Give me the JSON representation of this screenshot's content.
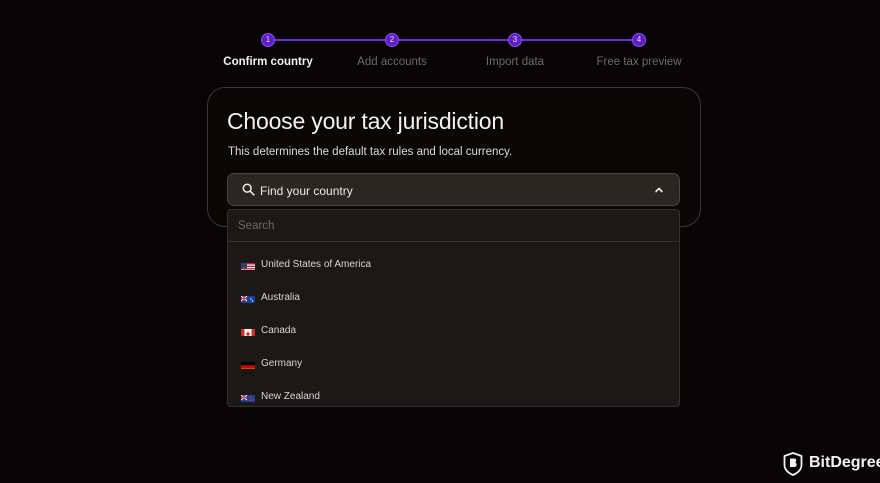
{
  "stepper": {
    "steps": [
      {
        "number": "1",
        "label": "Confirm country",
        "active": true
      },
      {
        "number": "2",
        "label": "Add accounts",
        "active": false
      },
      {
        "number": "3",
        "label": "Import data",
        "active": false
      },
      {
        "number": "4",
        "label": "Free tax preview",
        "active": false
      }
    ]
  },
  "card": {
    "title": "Choose your tax jurisdiction",
    "subtitle": "This determines the default tax rules and local currency."
  },
  "select": {
    "placeholder": "Find your country",
    "search_icon": "search-icon",
    "chevron_icon": "chevron-up-icon"
  },
  "dropdown": {
    "search_placeholder": "Search",
    "countries": [
      {
        "name": "United States of America",
        "flag": "us-flag-icon"
      },
      {
        "name": "Australia",
        "flag": "au-flag-icon"
      },
      {
        "name": "Canada",
        "flag": "ca-flag-icon"
      },
      {
        "name": "Germany",
        "flag": "de-flag-icon"
      },
      {
        "name": "New Zealand",
        "flag": "nz-flag-icon"
      }
    ]
  },
  "branding": {
    "name": "BitDegree",
    "logo_icon": "bitdegree-logo-icon"
  },
  "colors": {
    "background": "#070505",
    "accent": "#5b1fc4",
    "step_line": "#6b2bd9",
    "card_border": "#3a3633",
    "select_bg": "#2a2622",
    "dropdown_bg": "#1b1816"
  }
}
